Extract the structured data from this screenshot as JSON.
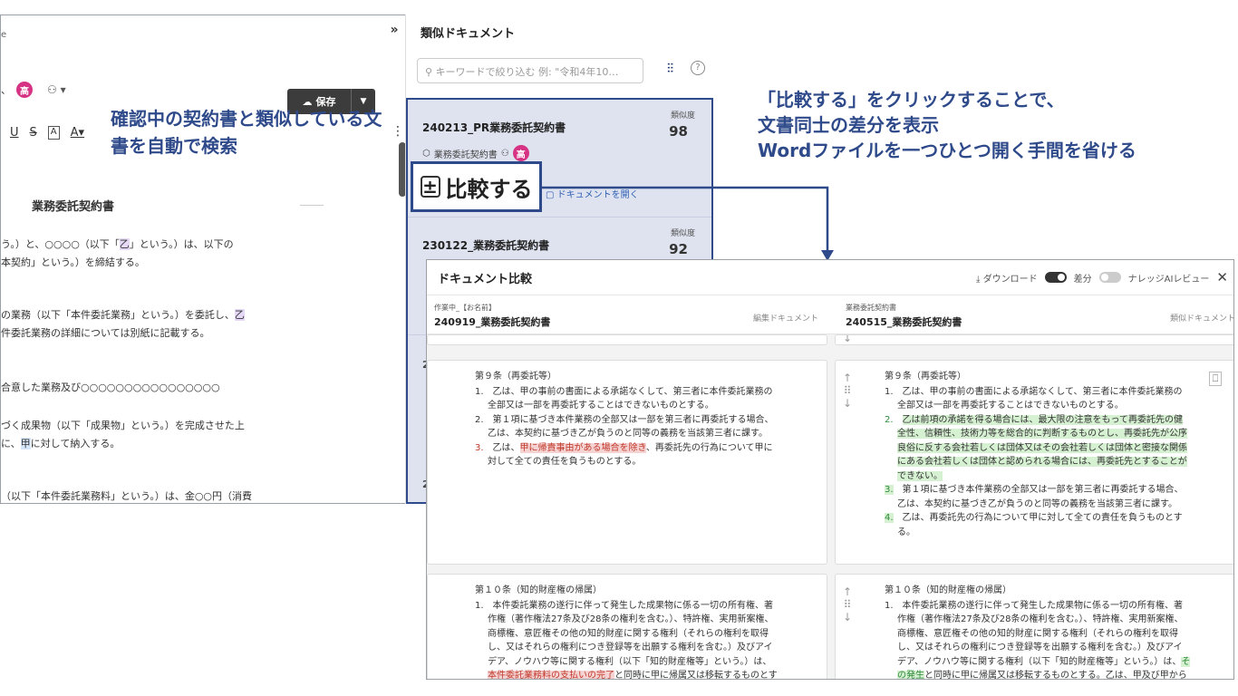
{
  "editor": {
    "tiny_text": "e",
    "avatar": "高",
    "save_label": "保存",
    "save_dropdown": "▼",
    "collapse": "»",
    "format": [
      "U",
      "S",
      "A",
      "A▾"
    ],
    "more": "⋮",
    "doc_title": "業務委託契約書",
    "lines": [
      {
        "pre": "う。）と、○○○○（以下「",
        "hl": "乙",
        "post": "」という。）は、以下の"
      },
      {
        "pre": "本契約」という。）を締結する。",
        "hl": "",
        "post": ""
      },
      {
        "pre": "の業務（以下「本件委託業務」という。）を委託し、",
        "hl": "乙",
        "post": ""
      },
      {
        "pre": "件委託業務の詳細については別紙に記載する。",
        "hl": "",
        "post": ""
      },
      {
        "pre": "合意した業務及び○○○○○○○○○○○○○○○○",
        "hl": "",
        "post": ""
      },
      {
        "pre": "づく成果物（以下「成果物」という。）を完成させた上",
        "hl": "",
        "post": ""
      },
      {
        "pre": "に、",
        "hl": "甲",
        "post": "に対して納入する。"
      },
      {
        "pre": "（以下「本件委託業務料」という。）は、金○○円（消費",
        "hl": "",
        "post": ""
      }
    ]
  },
  "annotations": {
    "left": "確認中の契約書と類似している文書を自動で検索",
    "right_line1": "「比較する」をクリックすることで、",
    "right_line2": "文書同士の差分を表示",
    "right_line3": "Wordファイルを一つひとつ開く手間を省ける"
  },
  "similar": {
    "title": "類似ドキュメント",
    "search_placeholder": "キーワードで絞り込む 例: \"令和4年10…",
    "help": "?",
    "similarity_label": "類似度",
    "results": [
      {
        "name": "240213_PR業務委託契約書",
        "score": "98",
        "category": "業務委託契約書",
        "avatar": "高",
        "open": "ドキュメントを開く"
      },
      {
        "name": "230122_業務委託契約書",
        "score": "92"
      }
    ],
    "stub_text": "2"
  },
  "compare_button": "比較する",
  "compare": {
    "title": "ドキュメント比較",
    "download": "ダウンロード",
    "diff": "差分",
    "knowledge": "ナレッジAIレビュー",
    "close": "✕",
    "left_label": "作業中_【お名前】",
    "left_name": "240919_業務委託契約書",
    "left_tag": "編集ドキュメント",
    "right_label": "業務委託契約書",
    "right_name": "240515_業務委託契約書",
    "right_tag": "類似ドキュメント",
    "left_c9": {
      "title": "第９条（再委託等）",
      "i1": "1.　乙は、甲の事前の書面による承諾なくして、第三者に本件委託業務の全部又は一部を再委託することはできないものとする。",
      "i2": "2.　第１項に基づき本件業務の全部又は一部を第三者に再委託する場合、乙は、本契約に基づき乙が負うのと同等の義務を当該第三者に課す。",
      "i3_num": "3.",
      "i3_pre": "　乙は、",
      "i3_hl": "甲に帰責事由がある場合を除き",
      "i3_post": "、再委託先の行為について甲に対して全ての責任を負うものとする。"
    },
    "right_c9": {
      "title": "第９条（再委託等）",
      "i1": "1.　乙は、甲の事前の書面による承諾なくして、第三者に本件委託業務の全部又は一部を再委託することはできないものとする。",
      "i2_num": "2.",
      "i2_hl": "乙は前項の承諾を得る場合には、最大限の注意をもって再委託先の健全性、信頼性、技術力等を総合的に判断するものとし、再委託先が公序良俗に反する会社若しくは団体又はその会社若しくは団体と密接な関係にある会社若しくは団体と認められる場合には、再委託先とすることができない。",
      "i3_num": "3.",
      "i3": "　第１項に基づき本件業務の全部又は一部を第三者に再委託する場合、乙は、本契約に基づき乙が負うのと同等の義務を当該第三者に課す。",
      "i4_num": "4.",
      "i4": "　乙は、再委託先の行為について甲に対して全ての責任を負うものとする。"
    },
    "left_c10": {
      "title": "第１０条（知的財産権の帰属）",
      "i1_pre": "1.　本件委託業務の遂行に伴って発生した成果物に係る一切の所有権、著作権（著作権法27条及び28条の権利を含む。）、特許権、実用新案権、商標権、意匠権その他の知的財産に関する権利（それらの権利を取得し、又はそれらの権利につき登録等を出願する権利を含む。）及びアイデア、ノウハウ等に関する権利（以下「知的財産権等」という。）は、",
      "i1_hl": "本件委託業務料の支払いの完了",
      "i1_post": "と同時に甲に帰属又は移転するものとする。乙は、甲及び甲から権利を承継し又は許諾された者に対し、著作者人格権"
    },
    "right_c10": {
      "title": "第１０条（知的財産権の帰属）",
      "i1_pre": "1.　本件委託業務の遂行に伴って発生した成果物に係る一切の所有権、著作権（著作権法27条及び28条の権利を含む。）、特許権、実用新案権、商標権、意匠権その他の知的財産に関する権利（それらの権利を取得し、又はそれらの権利につき登録等を出願する権利を含む。）及びアイデア、ノウハウ等に関する権利（以下「知的財産権等」という。）は、",
      "i1_hl": "その発生",
      "i1_post": "と同時に甲に帰属又は移転するものとする。乙は、甲及び甲から権利を承継し又は許諾された者に対し、著作者人格権"
    }
  }
}
